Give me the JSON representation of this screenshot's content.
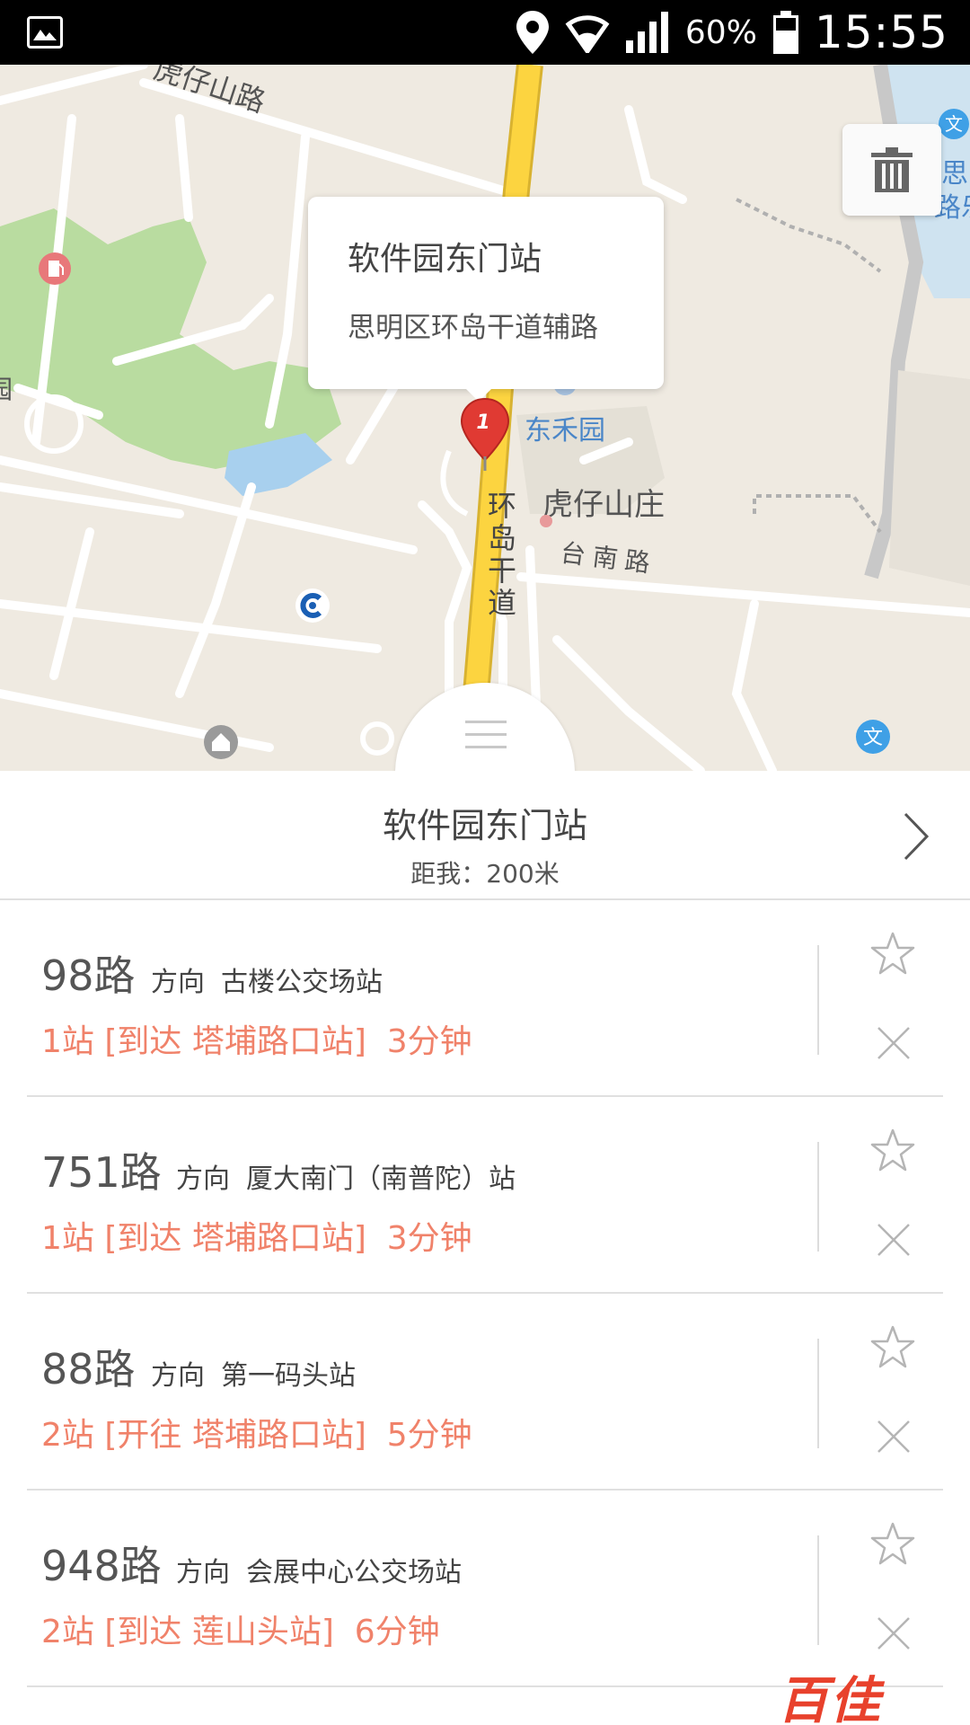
{
  "status_bar": {
    "battery": "60%",
    "time": "15:55"
  },
  "map": {
    "road_labels": {
      "huzai_shan_road": "虎仔山路",
      "huandao_road": "环岛干道",
      "tainan_road": "台南路",
      "huzai_shanzhuang": "虎仔山庄",
      "donghe_yuan": "东禾园",
      "right_edge_1": "思",
      "right_edge_2": "路乐",
      "left_edge": "园",
      "school_icon": "文"
    },
    "popup": {
      "name": "软件园东门站",
      "address": "思明区环岛干道辅路"
    },
    "pin_number": "1",
    "icons": [
      "trash-icon",
      "gas-station-icon",
      "bank-icon",
      "school-icon",
      "house-icon"
    ]
  },
  "station": {
    "name": "软件园东门站",
    "distance": "距我：200米"
  },
  "routes": [
    {
      "number": "98路",
      "direction_label": "方向",
      "direction": "古楼公交场站",
      "status": "1站 [到达 塔埔路口站]  3分钟"
    },
    {
      "number": "751路",
      "direction_label": "方向",
      "direction": "厦大南门（南普陀）站",
      "status": "1站 [到达 塔埔路口站]  3分钟"
    },
    {
      "number": "88路",
      "direction_label": "方向",
      "direction": "第一码头站",
      "status": "2站 [开往 塔埔路口站]  5分钟"
    },
    {
      "number": "948路",
      "direction_label": "方向",
      "direction": "会展中心公交场站",
      "status": "2站 [到达 莲山头站]  6分钟"
    }
  ],
  "watermark": "百佳",
  "colors": {
    "accent_status": "#f0826a",
    "road_yellow": "#fcd440",
    "map_bg": "#efeae1",
    "park_green": "#b9dca0",
    "water_blue": "#a8d0ee"
  }
}
